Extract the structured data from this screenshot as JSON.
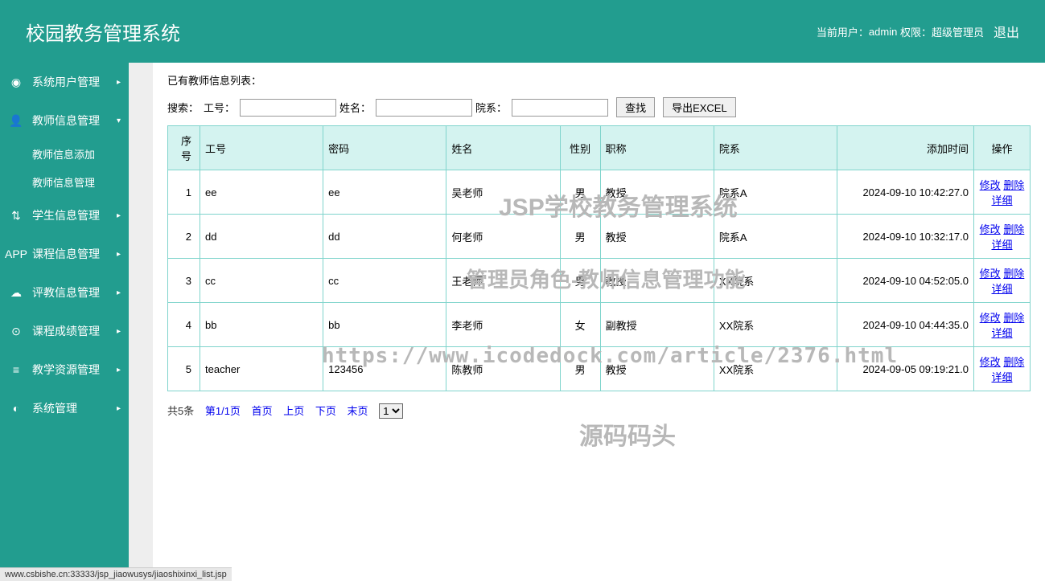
{
  "header": {
    "title": "校园教务管理系统",
    "currentUserLabel": "当前用户：",
    "currentUser": "admin",
    "roleLabel": "权限：",
    "role": "超级管理员",
    "logout": "退出"
  },
  "sidebar": {
    "items": [
      {
        "icon": "◉",
        "label": "系统用户管理",
        "arrow": "▸"
      },
      {
        "icon": "👤",
        "label": "教师信息管理",
        "arrow": "▾",
        "subs": [
          "教师信息添加",
          "教师信息管理"
        ]
      },
      {
        "icon": "⇅",
        "label": "学生信息管理",
        "arrow": "▸"
      },
      {
        "icon": "APP",
        "label": "课程信息管理",
        "arrow": "▸"
      },
      {
        "icon": "☁",
        "label": "评教信息管理",
        "arrow": "▸"
      },
      {
        "icon": "⊙",
        "label": "课程成绩管理",
        "arrow": "▸"
      },
      {
        "icon": "≡",
        "label": "教学资源管理",
        "arrow": "▸"
      },
      {
        "icon": "◐",
        "label": "系统管理",
        "arrow": "▸"
      }
    ]
  },
  "main": {
    "listTitle": "已有教师信息列表：",
    "search": {
      "label": "搜索：",
      "idLabel": "工号：",
      "nameLabel": "姓名：",
      "deptLabel": "院系：",
      "searchBtn": "查找",
      "exportBtn": "导出EXCEL"
    },
    "columns": [
      "序号",
      "工号",
      "密码",
      "姓名",
      "性别",
      "职称",
      "院系",
      "添加时间",
      "操作"
    ],
    "rows": [
      {
        "seq": "1",
        "id": "ee",
        "pwd": "ee",
        "name": "吴老师",
        "gender": "男",
        "title": "教授",
        "dept": "院系A",
        "time": "2024-09-10 10:42:27.0"
      },
      {
        "seq": "2",
        "id": "dd",
        "pwd": "dd",
        "name": "何老师",
        "gender": "男",
        "title": "教授",
        "dept": "院系A",
        "time": "2024-09-10 10:32:17.0"
      },
      {
        "seq": "3",
        "id": "cc",
        "pwd": "cc",
        "name": "王老师",
        "gender": "男",
        "title": "教授",
        "dept": "XX院系",
        "time": "2024-09-10 04:52:05.0"
      },
      {
        "seq": "4",
        "id": "bb",
        "pwd": "bb",
        "name": "李老师",
        "gender": "女",
        "title": "副教授",
        "dept": "XX院系",
        "time": "2024-09-10 04:44:35.0"
      },
      {
        "seq": "5",
        "id": "teacher",
        "pwd": "123456",
        "name": "陈教师",
        "gender": "男",
        "title": "教授",
        "dept": "XX院系",
        "time": "2024-09-05 09:19:21.0"
      }
    ],
    "actions": {
      "edit": "修改",
      "delete": "删除",
      "detail": "详细"
    },
    "pagination": {
      "total": "共5条",
      "page": "第1/1页",
      "first": "首页",
      "prev": "上页",
      "next": "下页",
      "last": "末页",
      "selectValue": "1"
    }
  },
  "watermarks": {
    "w1": "JSP学校教务管理系统",
    "w2": "管理员角色-教师信息管理功能",
    "w3": "https://www.icodedock.com/article/2376.html",
    "w4": "源码码头"
  },
  "statusBar": "www.csbishe.cn:33333/jsp_jiaowusys/jiaoshixinxi_list.jsp"
}
